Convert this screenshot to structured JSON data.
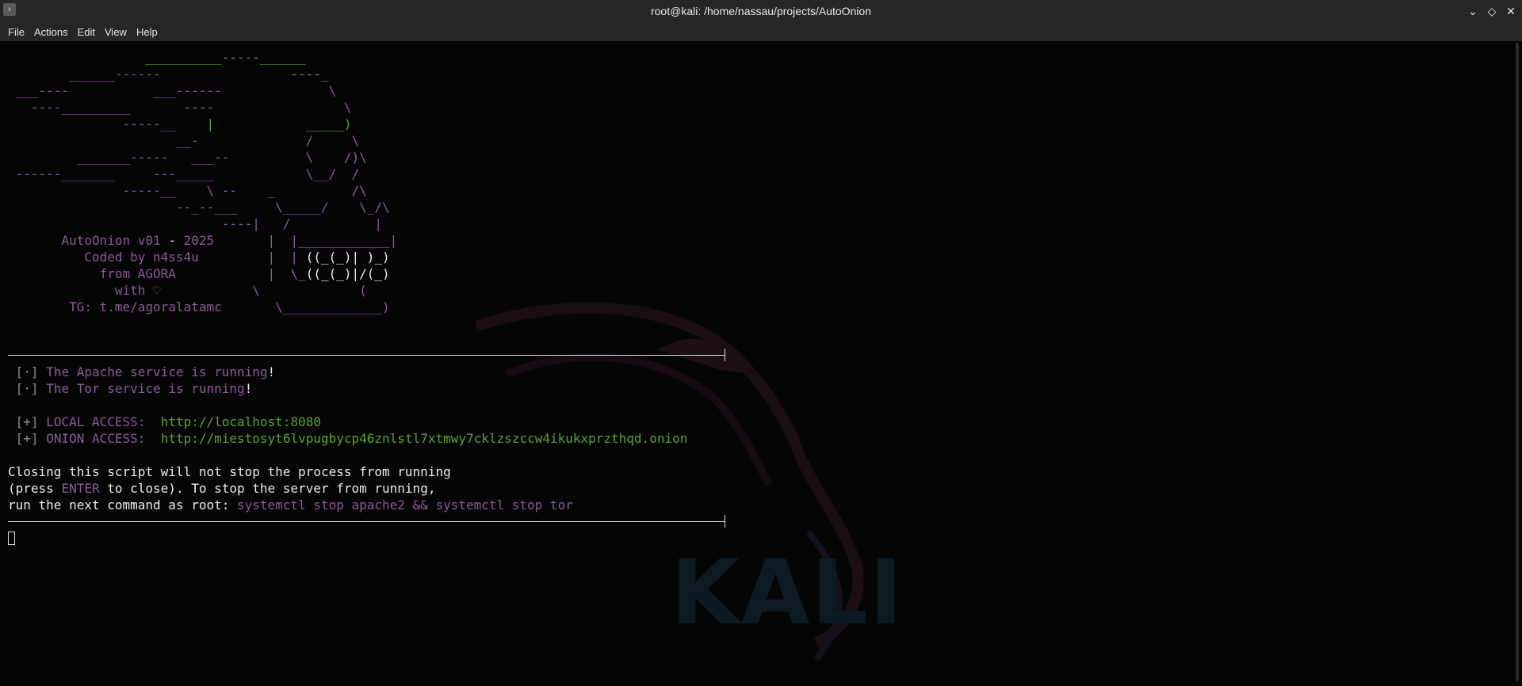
{
  "window": {
    "title": "root@kali: /home/nassau/projects/AutoOnion",
    "app_icon": "terminal-icon",
    "controls": [
      "minimize-icon",
      "maximize-icon",
      "close-icon"
    ]
  },
  "menu": {
    "items": [
      "File",
      "Actions",
      "Edit",
      "View",
      "Help"
    ]
  },
  "banner": {
    "name": "AutoOnion v01",
    "dash": "-",
    "year": "2025",
    "coded_by": "Coded by n4ss4u",
    "from": "from AGORA",
    "with": "with ♡",
    "tg": "TG: t.me/agoralatamc"
  },
  "status": {
    "bullet": "[·]",
    "apache_text": "The Apache service is running",
    "tor_text": "The Tor service is running",
    "exclaim": "!"
  },
  "access": {
    "bullet": "[+]",
    "local_label": "LOCAL ACCESS:",
    "local_url": "http://localhost:8080",
    "onion_label": "ONION ACCESS:",
    "onion_url": "http://miestosyt6lvpugbycp46znlstl7xtmwy7cklzszccw4ikukxprzthqd.onion"
  },
  "notice": {
    "line1": "Closing this script will not stop the process from running",
    "line2_prefix": "(press ",
    "line2_key": "ENTER",
    "line2_suffix": " to close). To stop the server from running,",
    "line3_prefix": "run the next command as root: ",
    "line3_command": "systemctl stop apache2 && systemctl stop tor"
  },
  "watermark": {
    "text": "KALI"
  },
  "colors": {
    "purple": "#8a5a98",
    "green": "#5aa328",
    "background": "#050505"
  }
}
